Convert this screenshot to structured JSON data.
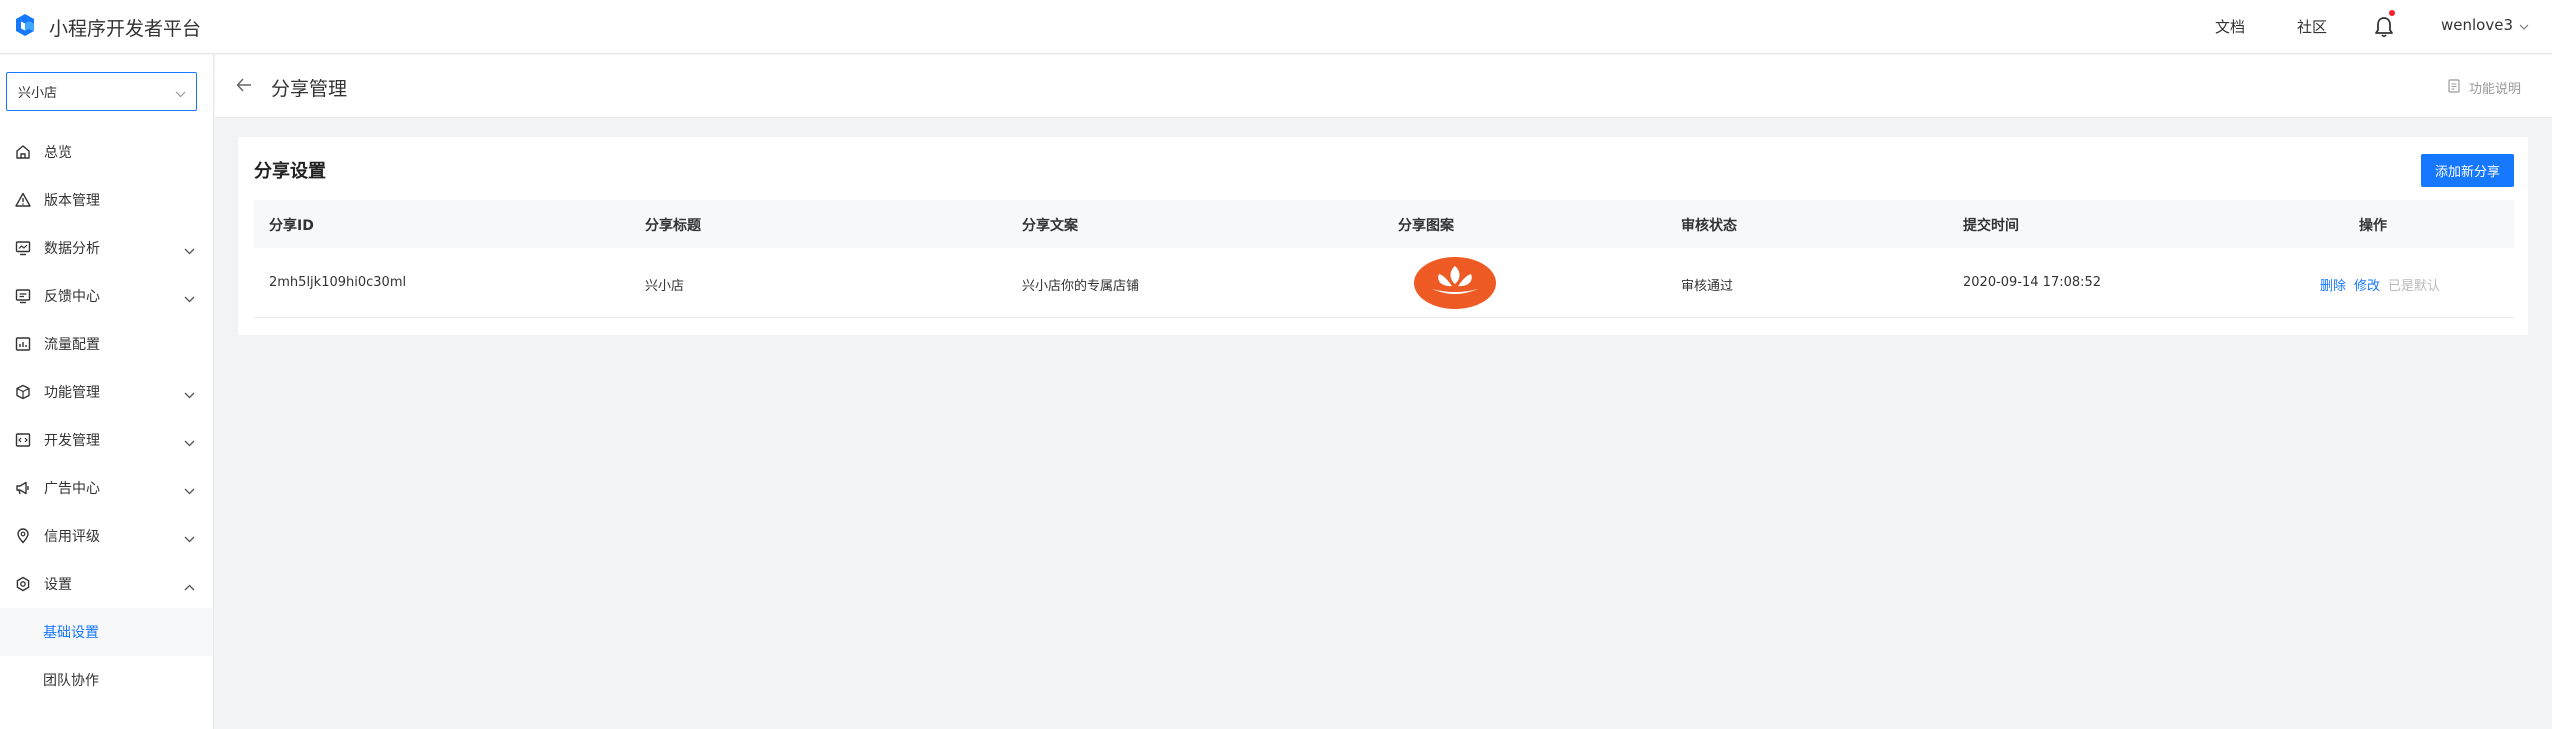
{
  "header": {
    "title": "小程序开发者平台",
    "links": [
      "文档",
      "社区"
    ],
    "username": "wenlove3"
  },
  "sidebar": {
    "store_select": "兴小店",
    "items": [
      {
        "label": "总览",
        "icon": "home-icon"
      },
      {
        "label": "版本管理",
        "icon": "warning-triangle-icon"
      },
      {
        "label": "数据分析",
        "icon": "monitor-chart-icon",
        "expandable": true
      },
      {
        "label": "反馈中心",
        "icon": "message-box-icon",
        "expandable": true
      },
      {
        "label": "流量配置",
        "icon": "bar-chart-icon"
      },
      {
        "label": "功能管理",
        "icon": "cube-icon",
        "expandable": true
      },
      {
        "label": "开发管理",
        "icon": "code-icon",
        "expandable": true
      },
      {
        "label": "广告中心",
        "icon": "megaphone-icon",
        "expandable": true
      },
      {
        "label": "信用评级",
        "icon": "location-pin-icon",
        "expandable": true
      },
      {
        "label": "设置",
        "icon": "gear-icon",
        "expanded": true
      }
    ],
    "sub_items": [
      {
        "label": "基础设置",
        "active": true
      },
      {
        "label": "团队协作",
        "active": false
      }
    ]
  },
  "page": {
    "title": "分享管理",
    "help_label": "功能说明"
  },
  "card": {
    "title": "分享设置",
    "add_button": "添加新分享"
  },
  "table": {
    "columns": [
      "分享ID",
      "分享标题",
      "分享文案",
      "分享图案",
      "审核状态",
      "提交时间",
      "操作"
    ],
    "rows": [
      {
        "id": "2mh5ljk109hi0c30ml",
        "title": "兴小店",
        "copy": "兴小店你的专属店铺",
        "image": "orange-lotus-logo",
        "status": "审核通过",
        "time": "2020-09-14 17:08:52",
        "actions": [
          "删除",
          "修改",
          "已是默认"
        ]
      }
    ]
  },
  "colors": {
    "accent": "#1677ff",
    "logo_orange": "#ee5a24",
    "notification_dot": "#f5222d"
  }
}
